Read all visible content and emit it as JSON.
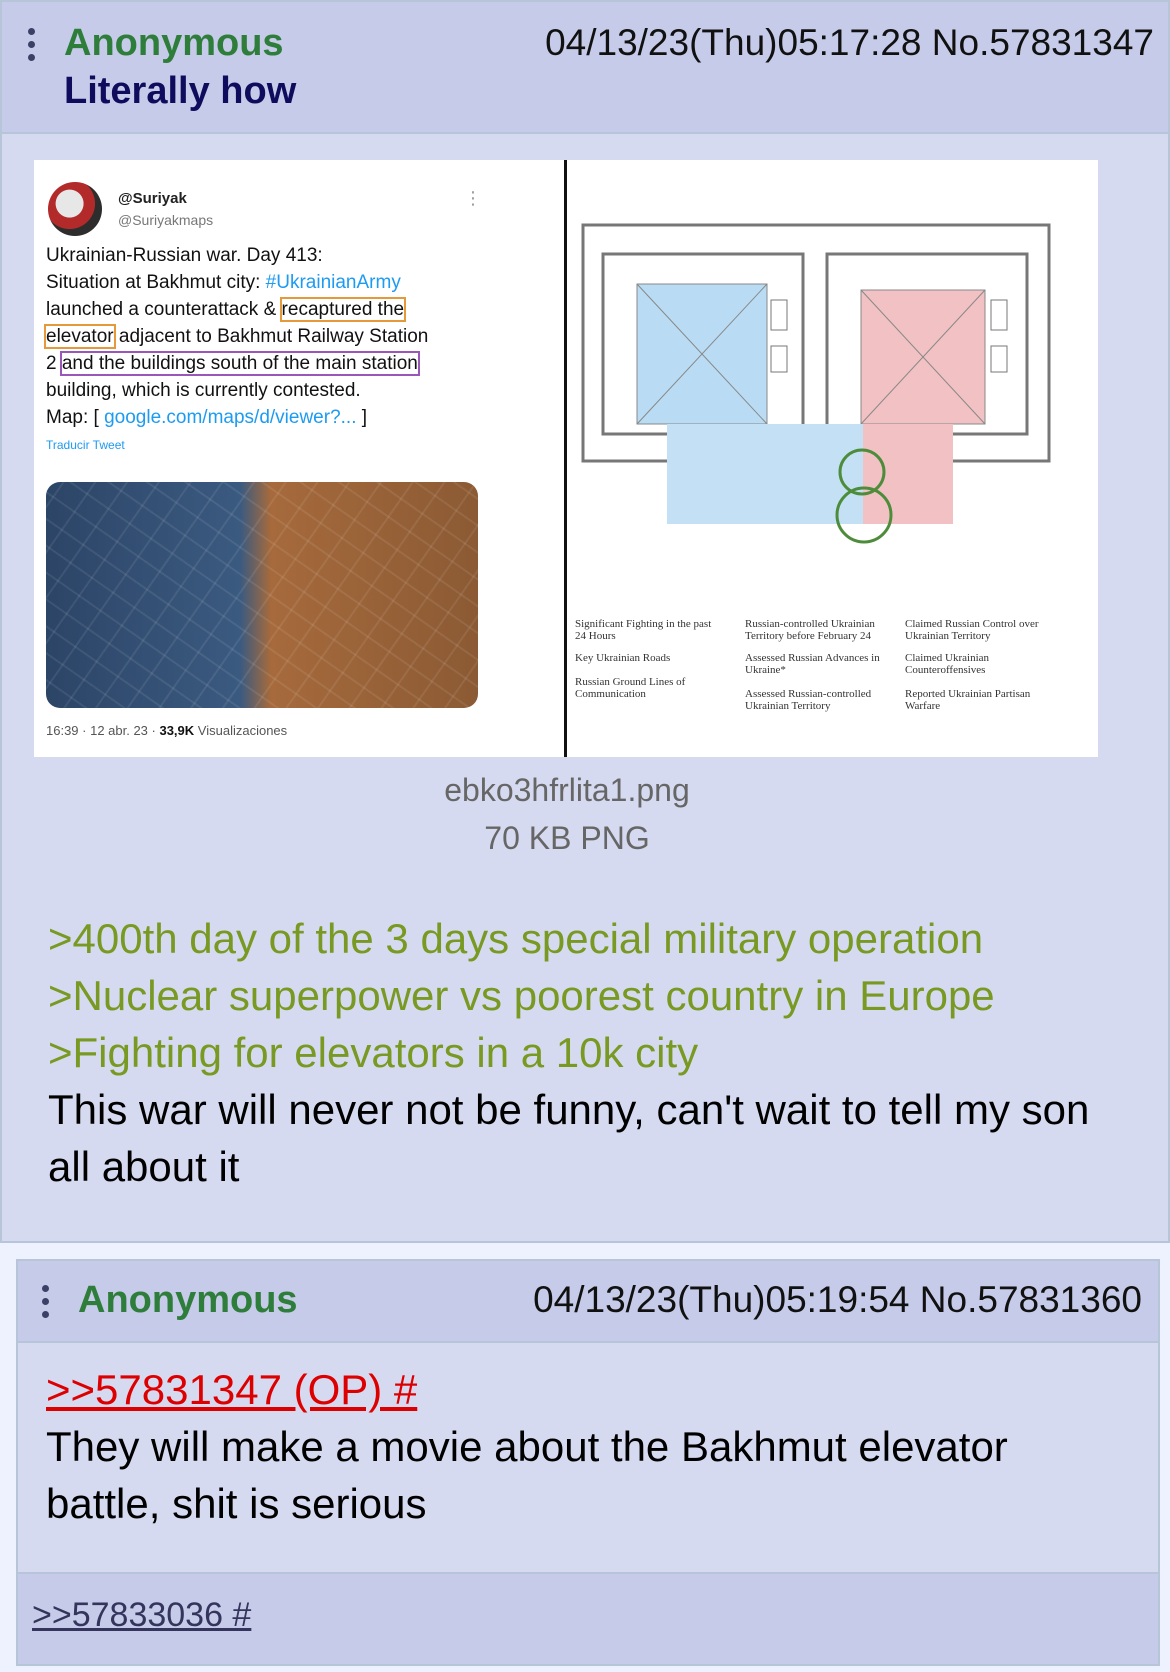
{
  "op": {
    "name": "Anonymous",
    "subject": "Literally how",
    "datetime_no": "04/13/23(Thu)05:17:28 No.57831347",
    "file": {
      "name": "ebko3hfrlita1.png",
      "size": "70 KB PNG",
      "tweet": {
        "user": "@Suriyak",
        "handle": "@Suriyakmaps",
        "line1": "Ukrainian-Russian war. Day 413:",
        "line2a": "Situation at Bakhmut city: ",
        "hashtag": "#UkrainianArmy",
        "line3a": "launched a counterattack & ",
        "box1": "recaptured the",
        "box2": "elevator",
        "line4b": " adjacent to Bakhmut Railway Station",
        "line5a": "2 ",
        "box3": "and the buildings south of the main station",
        "line6": "building, which is currently contested.",
        "line7a": "Map: [ ",
        "maplink": "google.com/maps/d/viewer?...",
        "line7b": " ]",
        "translate": "Traducir Tweet",
        "meta_time": "16:39 · 12 abr. 23 · ",
        "meta_views": "33,9K",
        "meta_views_label": " Visualizaciones"
      },
      "legend": [
        "Significant Fighting in the past 24 Hours",
        "Russian-controlled Ukrainian Territory before February 24",
        "Claimed Russian Control over Ukrainian Territory",
        "Key Ukrainian Roads",
        "Assessed Russian Advances in Ukraine*",
        "Claimed Ukrainian Counteroffensives",
        "Russian Ground Lines of Communication",
        "Assessed Russian-controlled Ukrainian Territory",
        "Reported Ukrainian Partisan Warfare"
      ]
    },
    "greentext": [
      ">400th day of the 3 days special military operation",
      ">Nuclear superpower vs poorest country in Europe",
      ">Fighting for elevators in a 10k city"
    ],
    "text": "This war will never not be funny, can't wait to tell my son all about it"
  },
  "reply": {
    "name": "Anonymous",
    "datetime_no": "04/13/23(Thu)05:19:54 No.57831360",
    "quote": ">>57831347 (OP) #",
    "text": "They will make a movie about the Bakhmut elevator battle, shit is serious",
    "backlink": ">>57833036 #"
  },
  "colors": {
    "post_bg": "#d6daf0",
    "header_bg": "#c5cbe8",
    "name": "#2f7d3b",
    "subject": "#0f0c5d",
    "greentext": "#789922",
    "quotelink": "#dd0000"
  }
}
